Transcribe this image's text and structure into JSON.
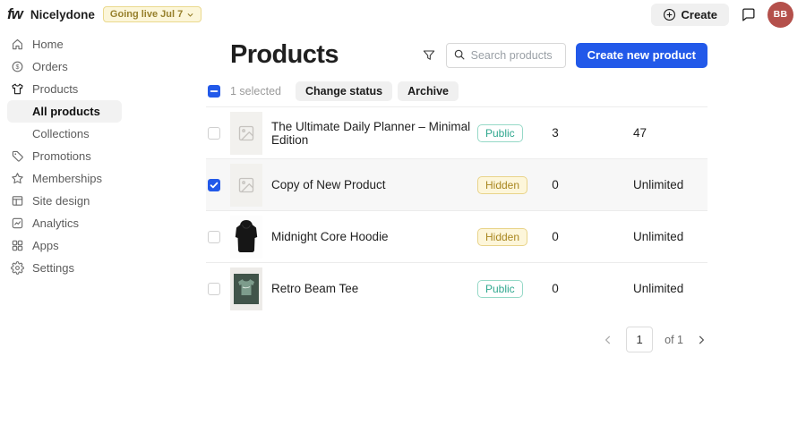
{
  "topbar": {
    "logo": "fw",
    "store_name": "Nicelydone",
    "status_badge": "Going live Jul 7",
    "create_label": "Create",
    "avatar_initials": "BB"
  },
  "sidebar": {
    "items": [
      {
        "label": "Home",
        "icon": "home-icon"
      },
      {
        "label": "Orders",
        "icon": "orders-icon"
      },
      {
        "label": "Products",
        "icon": "products-icon",
        "active": true
      },
      {
        "label": "All products",
        "sub": true,
        "selected": true
      },
      {
        "label": "Collections",
        "sub": true
      },
      {
        "label": "Promotions",
        "icon": "promotions-icon"
      },
      {
        "label": "Memberships",
        "icon": "memberships-icon"
      },
      {
        "label": "Site design",
        "icon": "site-design-icon"
      },
      {
        "label": "Analytics",
        "icon": "analytics-icon"
      },
      {
        "label": "Apps",
        "icon": "apps-icon"
      },
      {
        "label": "Settings",
        "icon": "settings-icon"
      }
    ]
  },
  "main": {
    "title": "Products",
    "search_placeholder": "Search products",
    "create_button": "Create new product",
    "selection": {
      "count_label": "1 selected",
      "change_status_label": "Change status",
      "archive_label": "Archive"
    },
    "table": {
      "rows": [
        {
          "name": "The Ultimate Daily Planner – Minimal Edition",
          "status": "Public",
          "quantity": "3",
          "inventory": "47",
          "checked": false,
          "thumb": "placeholder"
        },
        {
          "name": "Copy of New Product",
          "status": "Hidden",
          "quantity": "0",
          "inventory": "Unlimited",
          "checked": true,
          "thumb": "placeholder"
        },
        {
          "name": "Midnight Core Hoodie",
          "status": "Hidden",
          "quantity": "0",
          "inventory": "Unlimited",
          "checked": false,
          "thumb": "hoodie"
        },
        {
          "name": "Retro Beam Tee",
          "status": "Public",
          "quantity": "0",
          "inventory": "Unlimited",
          "checked": false,
          "thumb": "tee"
        }
      ]
    },
    "pagination": {
      "page": "1",
      "of_label": "of 1"
    }
  },
  "colors": {
    "accent_blue": "#2259e9",
    "avatar_bg": "#b4504b",
    "public_green": "#2fa78e",
    "hidden_yellow_text": "#a8861f",
    "hidden_yellow_bg": "#fdf6da",
    "live_badge_bg": "#fcf6d9"
  }
}
